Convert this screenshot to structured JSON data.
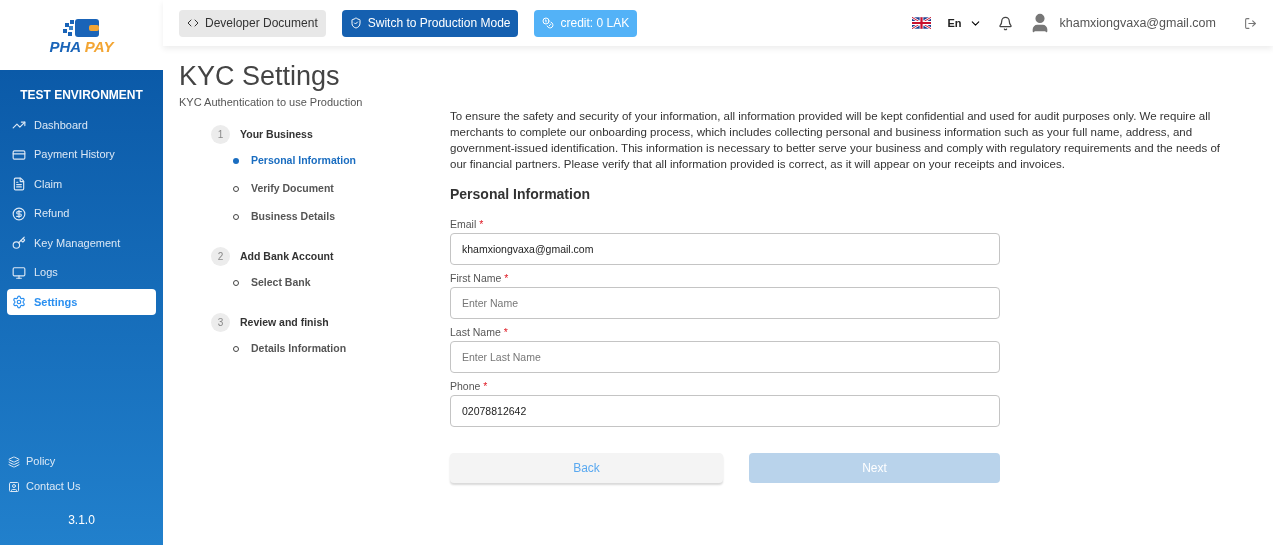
{
  "logo": {
    "line1": "PHA",
    "line2": "PAY"
  },
  "header": {
    "buttons": [
      {
        "label": "Developer Document",
        "kind": "doc"
      },
      {
        "label": "Switch to Production Mode",
        "kind": "production"
      },
      {
        "label": "credit: 0 LAK",
        "kind": "credit"
      }
    ],
    "language": "En",
    "user_email": "khamxiongvaxa@gmail.com"
  },
  "sidebar": {
    "environment": "TEST ENVIRONMENT",
    "items": [
      {
        "label": "Dashboard",
        "selected": false
      },
      {
        "label": "Payment History",
        "selected": false
      },
      {
        "label": "Claim",
        "selected": false
      },
      {
        "label": "Refund",
        "selected": false
      },
      {
        "label": "Key Management",
        "selected": false
      },
      {
        "label": "Logs",
        "selected": false
      },
      {
        "label": "Settings",
        "selected": true
      }
    ],
    "footer_items": [
      {
        "label": "Policy"
      },
      {
        "label": "Contact Us"
      }
    ],
    "version": "3.1.0"
  },
  "page": {
    "title": "KYC Settings",
    "subtitle": "KYC Authentication to use Production"
  },
  "steps": [
    {
      "number": "1",
      "label": "Your Business",
      "substeps": [
        {
          "label": "Personal Information",
          "selected": true
        },
        {
          "label": "Verify Document",
          "selected": false
        },
        {
          "label": "Business Details",
          "selected": false
        }
      ]
    },
    {
      "number": "2",
      "label": "Add Bank Account",
      "substeps": [
        {
          "label": "Select Bank",
          "selected": false
        }
      ]
    },
    {
      "number": "3",
      "label": "Review and finish",
      "substeps": [
        {
          "label": "Details Information",
          "selected": false
        }
      ]
    }
  ],
  "notice": "To ensure the safety and security of your information, all information provided will be kept confidential and used for audit purposes only. We require all merchants to complete our onboarding process, which includes collecting personal and business information such as your full name, address, and government-issued identification. This information is necessary to better serve your business and comply with regulatory requirements and the needs of our financial partners. Please verify that all information provided is correct, as it will appear on your receipts and invoices.",
  "form": {
    "title": "Personal Information",
    "fields": [
      {
        "label": "Email",
        "required_mark": "*",
        "value": "khamxiongvaxa@gmail.com"
      },
      {
        "label": "First Name",
        "required_mark": "*",
        "placeholder": "Enter Name"
      },
      {
        "label": "Last Name",
        "required_mark": "*",
        "placeholder": "Enter Last Name"
      },
      {
        "label": "Phone",
        "required_mark": "*",
        "value": "02078812642"
      }
    ],
    "buttons": [
      {
        "label": "Back",
        "disabled": false,
        "kind": "secondary"
      },
      {
        "label": "Next",
        "disabled": true,
        "kind": "primary"
      }
    ]
  }
}
